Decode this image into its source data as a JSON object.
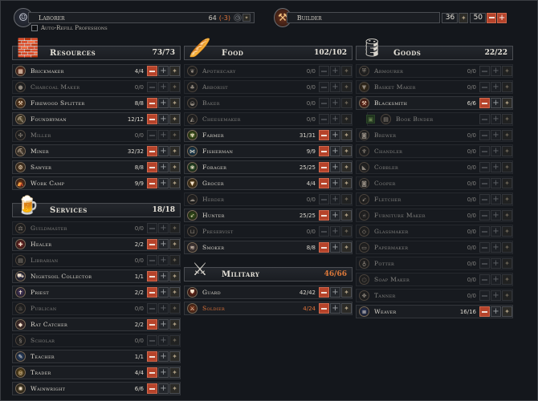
{
  "top": {
    "left_label": "Laborer",
    "left_value": "64",
    "left_extra": "(-3)",
    "autorefill_label": "Auto-Refill Professions",
    "right_label": "Builder",
    "right_value1": "36",
    "right_value2": "50"
  },
  "resources": {
    "title": "Resources",
    "count": "73/73",
    "rows": [
      {
        "name": "Brickmaker",
        "count": "4/4",
        "icon": "brick-icon",
        "dim": false,
        "active": true
      },
      {
        "name": "Charcoal Maker",
        "count": "0/0",
        "icon": "charcoal-icon",
        "dim": true,
        "active": false
      },
      {
        "name": "Firewood Splitter",
        "count": "8/8",
        "icon": "axe-icon",
        "dim": false,
        "active": true
      },
      {
        "name": "Foundryman",
        "count": "12/12",
        "icon": "anvil-icon",
        "dim": false,
        "active": true
      },
      {
        "name": "Miller",
        "count": "0/0",
        "icon": "mill-icon",
        "dim": true,
        "active": false
      },
      {
        "name": "Miner",
        "count": "32/32",
        "icon": "pickaxe-icon",
        "dim": false,
        "active": true
      },
      {
        "name": "Sawyer",
        "count": "8/8",
        "icon": "saw-icon",
        "dim": false,
        "active": true
      },
      {
        "name": "Work Camp",
        "count": "9/9",
        "icon": "camp-icon",
        "dim": false,
        "active": true
      }
    ]
  },
  "services": {
    "title": "Services",
    "count": "18/18",
    "rows": [
      {
        "name": "Guildmaster",
        "count": "0/0",
        "icon": "guild-icon",
        "dim": true,
        "active": false
      },
      {
        "name": "Healer",
        "count": "2/2",
        "icon": "cross-icon",
        "dim": false,
        "active": true
      },
      {
        "name": "Librarian",
        "count": "0/0",
        "icon": "book-icon",
        "dim": true,
        "active": false
      },
      {
        "name": "Nightsoil Collector",
        "count": "1/1",
        "icon": "cart-icon",
        "dim": false,
        "active": true
      },
      {
        "name": "Priest",
        "count": "2/2",
        "icon": "priest-icon",
        "dim": false,
        "active": true
      },
      {
        "name": "Publican",
        "count": "0/0",
        "icon": "mug-icon",
        "dim": true,
        "active": false
      },
      {
        "name": "Rat Catcher",
        "count": "2/2",
        "icon": "rat-icon",
        "dim": false,
        "active": true
      },
      {
        "name": "Scholar",
        "count": "0/0",
        "icon": "scroll-icon",
        "dim": true,
        "active": false
      },
      {
        "name": "Teacher",
        "count": "1/1",
        "icon": "teacher-icon",
        "dim": false,
        "active": true
      },
      {
        "name": "Trader",
        "count": "4/4",
        "icon": "coin-icon",
        "dim": false,
        "active": true
      },
      {
        "name": "Wainwright",
        "count": "6/6",
        "icon": "wheel-icon",
        "dim": false,
        "active": true
      }
    ]
  },
  "food": {
    "title": "Food",
    "count": "102/102",
    "rows": [
      {
        "name": "Apothecary",
        "count": "0/0",
        "icon": "herb-icon",
        "dim": true,
        "active": false
      },
      {
        "name": "Arborist",
        "count": "0/0",
        "icon": "tree-icon",
        "dim": true,
        "active": false
      },
      {
        "name": "Baker",
        "count": "0/0",
        "icon": "bread-icon",
        "dim": true,
        "active": false
      },
      {
        "name": "Cheesemaker",
        "count": "0/0",
        "icon": "cheese-icon",
        "dim": true,
        "active": false
      },
      {
        "name": "Farmer",
        "count": "31/31",
        "icon": "wheat-icon",
        "dim": false,
        "active": true
      },
      {
        "name": "Fisherman",
        "count": "9/9",
        "icon": "fish-icon",
        "dim": false,
        "active": true
      },
      {
        "name": "Forager",
        "count": "25/25",
        "icon": "berry-icon",
        "dim": false,
        "active": true
      },
      {
        "name": "Grocer",
        "count": "4/4",
        "icon": "basket-icon",
        "dim": false,
        "active": true
      },
      {
        "name": "Herder",
        "count": "0/0",
        "icon": "sheep-icon",
        "dim": true,
        "active": false
      },
      {
        "name": "Hunter",
        "count": "25/25",
        "icon": "bow-icon",
        "dim": false,
        "active": true
      },
      {
        "name": "Preservist",
        "count": "0/0",
        "icon": "jar-icon",
        "dim": true,
        "active": false
      },
      {
        "name": "Smoker",
        "count": "8/8",
        "icon": "smoke-icon",
        "dim": false,
        "active": true
      }
    ]
  },
  "military": {
    "title": "Military",
    "count": "46/66",
    "rows": [
      {
        "name": "Guard",
        "count": "42/42",
        "icon": "shield-icon",
        "dim": false,
        "active": true,
        "alert": false
      },
      {
        "name": "Soldier",
        "count": "4/24",
        "icon": "swords-icon",
        "dim": false,
        "active": true,
        "alert": true
      }
    ]
  },
  "goods": {
    "title": "Goods",
    "count": "22/22",
    "rows": [
      {
        "name": "Armourer",
        "count": "0/0",
        "icon": "armour-icon",
        "dim": true,
        "active": false
      },
      {
        "name": "Basket Maker",
        "count": "0/0",
        "icon": "basket-icon",
        "dim": true,
        "active": false
      },
      {
        "name": "Blacksmith",
        "count": "6/6",
        "icon": "hammer-icon",
        "dim": false,
        "active": true
      },
      {
        "name": "Book Binder",
        "count": "",
        "icon": "book-icon",
        "dim": true,
        "active": false,
        "sub": true
      },
      {
        "name": "Brewer",
        "count": "0/0",
        "icon": "barrel-icon",
        "dim": true,
        "active": false
      },
      {
        "name": "Chandler",
        "count": "0/0",
        "icon": "candle-icon",
        "dim": true,
        "active": false
      },
      {
        "name": "Cobbler",
        "count": "0/0",
        "icon": "boot-icon",
        "dim": true,
        "active": false
      },
      {
        "name": "Cooper",
        "count": "0/0",
        "icon": "barrel-icon",
        "dim": true,
        "active": false
      },
      {
        "name": "Fletcher",
        "count": "0/0",
        "icon": "arrow-icon",
        "dim": true,
        "active": false
      },
      {
        "name": "Furniture Maker",
        "count": "0/0",
        "icon": "chair-icon",
        "dim": true,
        "active": false
      },
      {
        "name": "Glassmaker",
        "count": "0/0",
        "icon": "glass-icon",
        "dim": true,
        "active": false
      },
      {
        "name": "Papermaker",
        "count": "0/0",
        "icon": "paper-icon",
        "dim": true,
        "active": false
      },
      {
        "name": "Potter",
        "count": "0/0",
        "icon": "pot-icon",
        "dim": true,
        "active": false
      },
      {
        "name": "Soap Maker",
        "count": "0/0",
        "icon": "soap-icon",
        "dim": true,
        "active": false
      },
      {
        "name": "Tanner",
        "count": "0/0",
        "icon": "hide-icon",
        "dim": true,
        "active": false
      },
      {
        "name": "Weaver",
        "count": "16/16",
        "icon": "loom-icon",
        "dim": false,
        "active": true
      }
    ]
  },
  "colors": {
    "accent": "#b6432a",
    "alert": "#e0743a",
    "panel": "#1a1d22"
  }
}
